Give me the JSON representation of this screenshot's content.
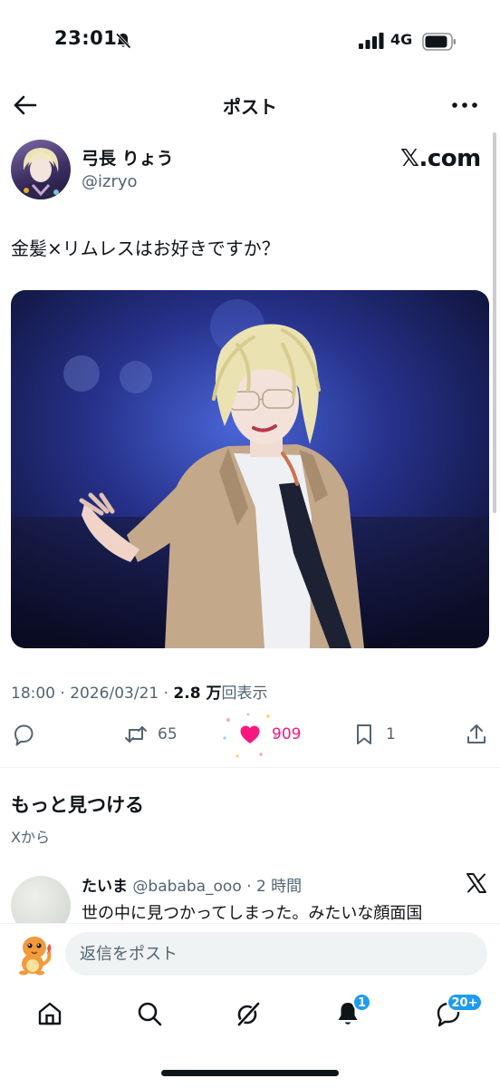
{
  "status_bar": {
    "time": "23:01",
    "network": "4G",
    "icons": [
      "bell-slash-icon",
      "signal-icon",
      "battery-icon"
    ]
  },
  "header": {
    "title": "ポスト",
    "icons": [
      "back-arrow-icon",
      "more-icon"
    ]
  },
  "post": {
    "author_name": "弓長 りょう",
    "author_handle": "@izryo",
    "source_mark": "𝕏.com",
    "text": "金髪×リムレスはお好きですか？",
    "time": "18:00",
    "date": "2026/03/21",
    "separator": "·",
    "views_count": "2.8 万",
    "views_label": "回表示",
    "actions": {
      "reply_count": "",
      "repost_count": "65",
      "like_count": "909",
      "bookmark_count": "1",
      "liked": true
    },
    "like_color": "#f91880"
  },
  "discover": {
    "title": "もっと見つける",
    "subtitle": "Xから"
  },
  "recommended_post": {
    "author_name": "たいま",
    "handle_and_time": "@bababa_ooo · 2 時間",
    "text": "世の中に見つかってしまった。みたいな顔面国"
  },
  "reply_bar": {
    "placeholder": "返信をポスト"
  },
  "tab_bar": {
    "notifications_badge": "1",
    "messages_badge": "20+",
    "badge_color": "#1d9bf0",
    "icons": [
      "home-icon",
      "search-icon",
      "grok-icon",
      "notifications-icon",
      "messages-icon"
    ]
  }
}
